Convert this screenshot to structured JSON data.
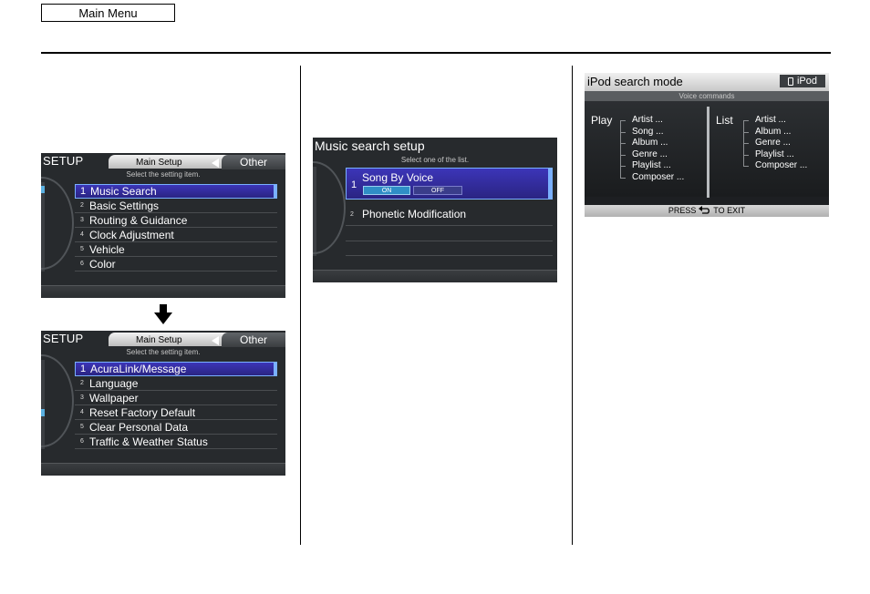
{
  "header": {
    "main_menu": "Main Menu"
  },
  "setup1": {
    "title": "SETUP",
    "tab_main": "Main Setup",
    "tab_other": "Other",
    "hint": "Select the setting item.",
    "items": [
      {
        "num": "1",
        "label": "Music Search"
      },
      {
        "num": "2",
        "label": "Basic Settings"
      },
      {
        "num": "3",
        "label": "Routing & Guidance"
      },
      {
        "num": "4",
        "label": "Clock Adjustment"
      },
      {
        "num": "5",
        "label": "Vehicle"
      },
      {
        "num": "6",
        "label": "Color"
      }
    ]
  },
  "setup2": {
    "title": "SETUP",
    "tab_main": "Main Setup",
    "tab_other": "Other",
    "hint": "Select the setting item.",
    "items": [
      {
        "num": "1",
        "label": "AcuraLink/Message"
      },
      {
        "num": "2",
        "label": "Language"
      },
      {
        "num": "3",
        "label": "Wallpaper"
      },
      {
        "num": "4",
        "label": "Reset Factory Default"
      },
      {
        "num": "5",
        "label": "Clear Personal Data"
      },
      {
        "num": "6",
        "label": "Traffic & Weather Status"
      }
    ]
  },
  "music_search": {
    "title": "Music search setup",
    "hint": "Select one of the list.",
    "item1_num": "1",
    "item1_label": "Song By Voice",
    "on": "ON",
    "off": "OFF",
    "item2_num": "2",
    "item2_label": "Phonetic Modification"
  },
  "ipod": {
    "title": "iPod search mode",
    "badge": "iPod",
    "voice_label": "Voice commands",
    "play_label": "Play",
    "play_items": [
      "Artist ...",
      "Song ...",
      "Album ...",
      "Genre ...",
      "Playlist ...",
      "Composer ..."
    ],
    "list_label": "List",
    "list_items": [
      "Artist ...",
      "Album ...",
      "Genre ...",
      "Playlist ...",
      "Composer ..."
    ],
    "footer_pre": "PRESS",
    "footer_post": "TO EXIT"
  }
}
